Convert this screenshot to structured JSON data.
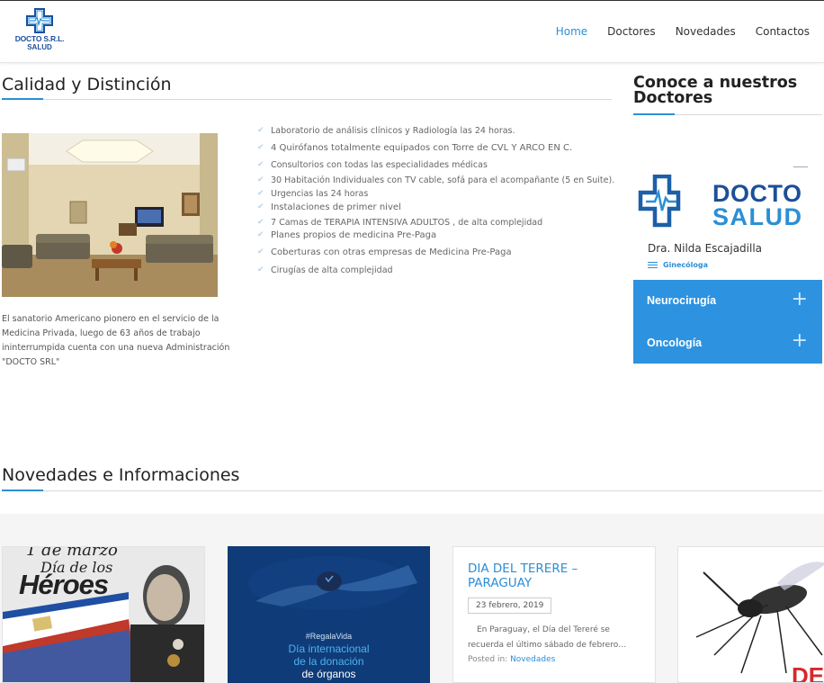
{
  "header": {
    "logo_line1": "DOCTO S.R.L.",
    "logo_line2": "SALUD",
    "nav": [
      "Home",
      "Doctores",
      "Novedades",
      "Contactos"
    ]
  },
  "main": {
    "title": "Calidad y Distinción",
    "intro": "El sanatorio Americano pionero en el servicio de la Medicina Privada, luego de 63 años de trabajo ininterrumpida cuenta con una nueva Administración \"DOCTO SRL\"",
    "features": [
      "Laboratorio de análisis clínicos y Radiología las 24 horas.",
      "4 Quirófanos   totalmente equipados  con Torre de  CVL  Y ARCO EN C.",
      "Consultorios con todas las especialidades médicas",
      "30 Habitación Individuales con  TV cable, sofá para el acompañante (5 en Suite).",
      "Urgencias las 24 horas",
      "Instalaciones de primer nivel",
      "7  Camas de TERAPIA INTENSIVA ADULTOS , de alta complejidad",
      "Planes propios de medicina Pre-Paga",
      "Coberturas con otras empresas de Medicina Pre-Paga",
      "Cirugías de alta complejidad"
    ]
  },
  "doctors": {
    "title": "Conoce a nuestros Doctores",
    "logo_top": "DOCTO",
    "logo_bottom": "SALUD",
    "doctor_name": "Dra. Nilda Escajadilla",
    "doctor_specialty": "Ginecóloga",
    "accordion": [
      "Neurocirugía",
      "Oncología"
    ]
  },
  "news": {
    "title": "Novedades e Informaciones",
    "card1": {
      "line1": "1 de marzo",
      "line2": "Día de los",
      "line3": "Héroes"
    },
    "card2": {
      "hashtag": "#RegalaVida",
      "line1": "Día internacional",
      "line2": "de la donación",
      "line3": "de órganos"
    },
    "card3": {
      "title": "DIA DEL TERERE – PARAGUAY",
      "date": "23 febrero, 2019",
      "excerpt": "En Paraguay, el Día del Tereré se recuerda el último sábado de febrero…",
      "posted_label": "Posted in:",
      "category": "Novedades"
    },
    "card4": {
      "partial_text": "DE"
    }
  },
  "colors": {
    "accent": "#2b8fd6",
    "brand_dark": "#1c4f9c",
    "accordion": "#2d92e0"
  }
}
